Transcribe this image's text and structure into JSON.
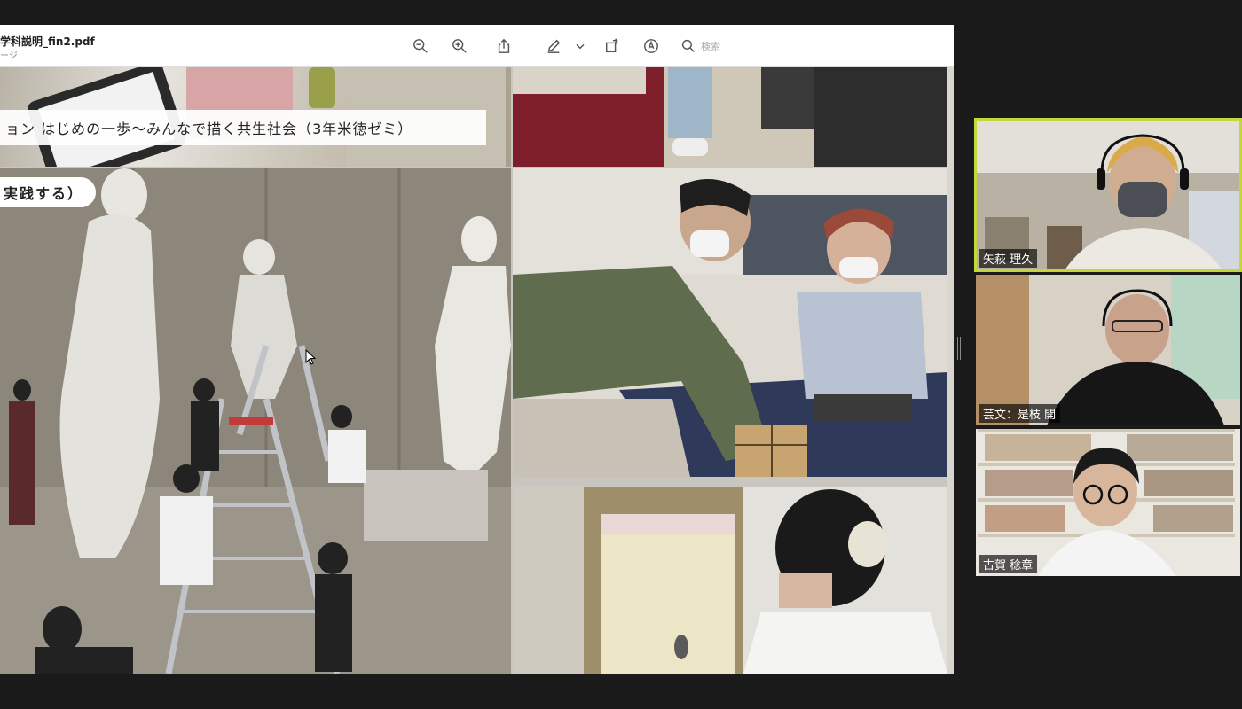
{
  "viewer": {
    "doc_title": "学科説明_fin2.pdf",
    "doc_subtitle": "ージ",
    "search_placeholder": "検索",
    "slide_title": "ョン はじめの一歩〜みんなで描く共生社会（3年米徳ゼミ）",
    "slide_badge": "実践する）"
  },
  "toolbar_icons": [
    "zoom-out-icon",
    "zoom-in-icon",
    "share-icon",
    "markup-pen-icon",
    "chevron-down-icon",
    "rotate-icon",
    "annotate-icon",
    "search-icon"
  ],
  "participants": [
    {
      "name": "矢萩 理久",
      "active": true
    },
    {
      "name": "芸文：是枝 開",
      "active": false
    },
    {
      "name": "古賀 稔章",
      "active": false
    }
  ],
  "colors": {
    "active_speaker_border": "#c4d63a",
    "background": "#1a1a1a"
  }
}
